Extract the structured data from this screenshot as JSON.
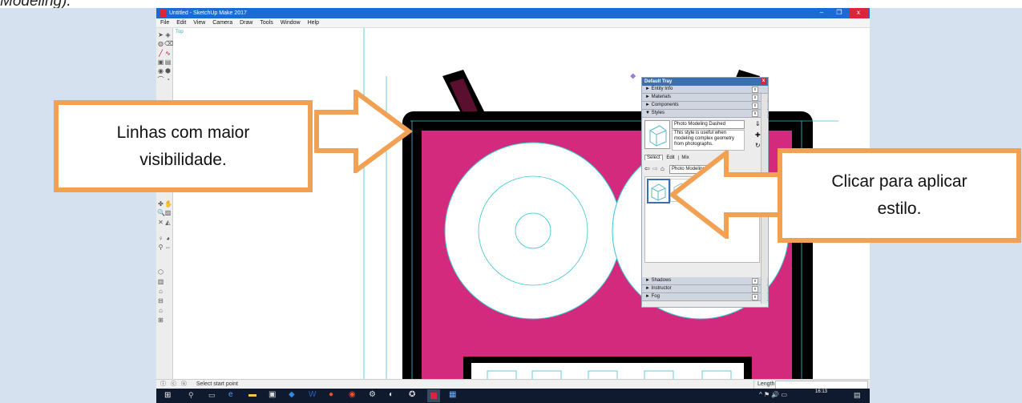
{
  "caption": "Modeling).",
  "window": {
    "title": "Untitled - SketchUp Make 2017",
    "minimize": "–",
    "maximize": "❐",
    "close": "x"
  },
  "menu": [
    "File",
    "Edit",
    "View",
    "Camera",
    "Draw",
    "Tools",
    "Window",
    "Help"
  ],
  "scene_label": "Top",
  "tray": {
    "title": "Default Tray",
    "close": "x",
    "sections_top": [
      {
        "label": "► Entity Info"
      },
      {
        "label": "► Materials"
      },
      {
        "label": "► Components"
      },
      {
        "label": "▼ Styles"
      }
    ],
    "style_name": "Photo Modeling Dashed",
    "style_description": "This style is useful when modeling complex geometry from photographs.",
    "tabs": [
      "Select",
      "Edit",
      "Mix"
    ],
    "collection": "Photo Modeling",
    "sections_bottom": [
      {
        "label": "► Shadows"
      },
      {
        "label": "► Instructor"
      },
      {
        "label": "► Fog"
      }
    ],
    "section_close": "x"
  },
  "status": {
    "text": "Select start point",
    "measure_label": "Length"
  },
  "taskbar": {
    "clock": "16:13"
  },
  "callouts": {
    "left": [
      "Linhas com maior",
      "visibilidade."
    ],
    "right": [
      "Clicar para aplicar",
      "estilo."
    ]
  },
  "colors": {
    "accent_orange": "#f2a154",
    "magenta_fill": "#d42a7e",
    "ear_dark": "#5a0f2e",
    "cyan_guides": "#37c6d0",
    "titlebar_blue": "#1b6bd4"
  }
}
